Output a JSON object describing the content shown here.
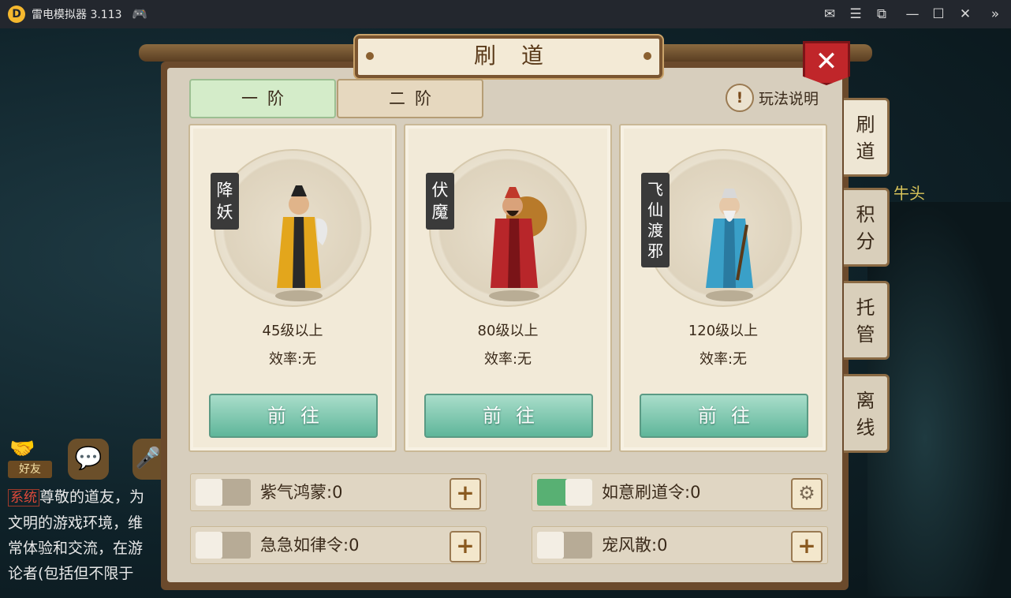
{
  "titlebar": {
    "logo": "D",
    "title": "雷电模拟器 3.113",
    "icons": [
      "gamepad-icon",
      "mail-icon",
      "menu-icon",
      "screenshot-icon",
      "minimize-icon",
      "maximize-icon",
      "close-icon",
      "collapse-icon"
    ]
  },
  "background": {
    "npc_label": "牛头",
    "friend_label": "好友",
    "chat": {
      "sys_tag": "系统",
      "line1": "尊敬的道友，为",
      "line2": "文明的游戏环境，维",
      "line3": "常体验和交流，在游",
      "line4": "论者(包括但不限于"
    }
  },
  "panel": {
    "title": "刷道",
    "close": "✕",
    "tabs": [
      {
        "label": "一阶",
        "active": true
      },
      {
        "label": "二阶",
        "active": false
      }
    ],
    "help": {
      "icon": "!",
      "label": "玩法说明"
    },
    "side_tabs": [
      {
        "label": "刷道",
        "active": true
      },
      {
        "label": "积分",
        "active": false
      },
      {
        "label": "托管",
        "active": false
      },
      {
        "label": "离线",
        "active": false
      }
    ],
    "cards": [
      {
        "name": "降妖",
        "level": "45级以上",
        "efficiency": "效率:无",
        "button": "前往"
      },
      {
        "name": "伏魔",
        "level": "80级以上",
        "efficiency": "效率:无",
        "button": "前往"
      },
      {
        "name": "飞仙渡邪",
        "level": "120级以上",
        "efficiency": "效率:无",
        "button": "前往"
      }
    ],
    "items": [
      {
        "label": "紫气鸿蒙:0",
        "enabled": false,
        "action": "plus-icon"
      },
      {
        "label": "如意刷道令:0",
        "enabled": true,
        "action": "gear-icon"
      },
      {
        "label": "急急如律令:0",
        "enabled": false,
        "action": "plus-icon"
      },
      {
        "label": "宠风散:0",
        "enabled": false,
        "action": "plus-icon"
      }
    ]
  },
  "colors": {
    "title_bar": "#23272e",
    "panel_bg": "#d7cebd",
    "tab_active": "#d4ecc9",
    "go_button": "#6fbfa4",
    "toggle_on": "#58b073",
    "close_red": "#c0262a"
  }
}
